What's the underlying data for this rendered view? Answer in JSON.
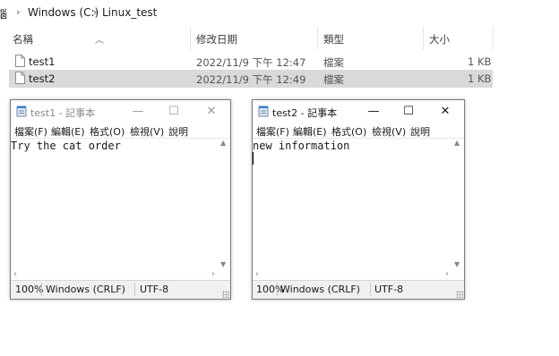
{
  "breadcrumb": {
    "root": "腦",
    "drive": "Windows (C:)",
    "folder": "Linux_test"
  },
  "columns": {
    "name": "名稱",
    "date": "修改日期",
    "type": "類型",
    "size": "大小"
  },
  "files": [
    {
      "name": "test1",
      "date": "2022/11/9 下午 12:47",
      "type": "檔案",
      "size": "1 KB",
      "selected": false
    },
    {
      "name": "test2",
      "date": "2022/11/9 下午 12:49",
      "type": "檔案",
      "size": "1 KB",
      "selected": true
    }
  ],
  "notepad1": {
    "title": "test1 - 記事本",
    "menu": {
      "file": "檔案(F)",
      "edit": "編輯(E)",
      "format": "格式(O)",
      "view": "檢視(V)",
      "help": "說明"
    },
    "content": "Try the cat order",
    "status": {
      "zoom": "100%",
      "eol": "Windows (CRLF)",
      "encoding": "UTF-8"
    },
    "controls": {
      "minimize": "—",
      "maximize": "☐",
      "close": "✕"
    }
  },
  "notepad2": {
    "title": "test2 - 記事本",
    "menu": {
      "file": "檔案(F)",
      "edit": "編輯(E)",
      "format": "格式(O)",
      "view": "檢視(V)",
      "help": "說明"
    },
    "content": "new information",
    "status": {
      "zoom": "100%",
      "eol": "Windows (CRLF)",
      "encoding": "UTF-8"
    },
    "controls": {
      "minimize": "—",
      "maximize": "☐",
      "close": "✕"
    }
  },
  "colors": {
    "selected_row": "#d9d9d9",
    "statusbar": "#f0f0f0",
    "accent_icon": "#3a7bd5"
  }
}
